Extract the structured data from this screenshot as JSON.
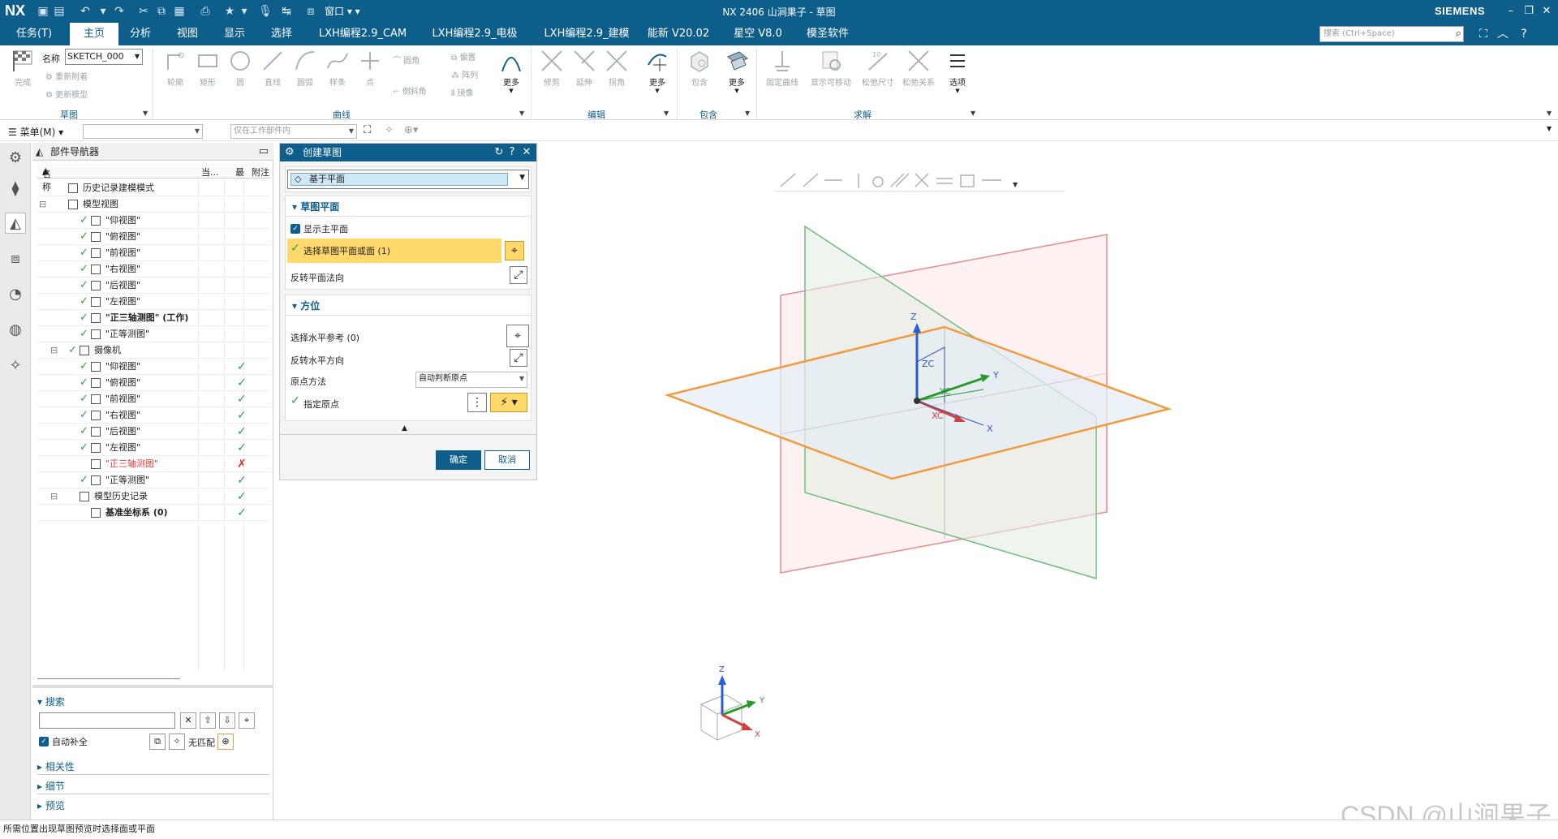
{
  "titlebar": {
    "logo": "NX",
    "title": "NX 2406 山涧果子 - 草图",
    "window_menu": "窗口",
    "brand": "SIEMENS"
  },
  "menu": {
    "tabs": [
      "任务(T)",
      "主页",
      "分析",
      "视图",
      "显示",
      "选择",
      "LXH编程2.9_CAM",
      "LXH编程2.9_电极",
      "LXH编程2.9_建模",
      "能新 V20.02",
      "星空 V8.0",
      "模圣软件"
    ],
    "active_tab": "主页",
    "search_placeholder": "搜索 (Ctrl+Space)"
  },
  "ribbon": {
    "sketch_group": {
      "finish": "完成",
      "name_label": "名称",
      "name_value": "SKETCH_000",
      "update_attach": "重新附着",
      "update_model": "更新模型",
      "label": "草图"
    },
    "curve_group": {
      "items": [
        "轮廓",
        "矩形",
        "圆",
        "直线",
        "圆弧",
        "样条",
        "点"
      ],
      "right_items": [
        "圆角",
        "倒斜角"
      ],
      "small_items": [
        "偏置",
        "阵列",
        "镜像"
      ],
      "more": "更多",
      "label": "曲线"
    },
    "edit_group": {
      "items": [
        "修剪",
        "延伸",
        "拐角"
      ],
      "more": "更多",
      "label": "编辑"
    },
    "include_group": {
      "items": [
        "包含"
      ],
      "more": "更多",
      "label": "包含"
    },
    "solve_group": {
      "items": [
        "固定曲线",
        "显示可移动",
        "松弛尺寸",
        "松弛关系"
      ],
      "options": "选项",
      "label": "求解"
    }
  },
  "toolbar2": {
    "menu": "菜单(M)",
    "filter_combo": "",
    "scope_combo": "仅在工作部件内"
  },
  "navigator": {
    "title": "部件导航器",
    "columns": [
      "名称",
      "当...",
      "最",
      "附注"
    ],
    "rows": [
      {
        "label": "历史记录建模模式",
        "indent": 0,
        "check": false,
        "col3": ""
      },
      {
        "label": "模型视图",
        "indent": 0,
        "check": false,
        "col3": "",
        "tree": "-"
      },
      {
        "label": "\"仰视图\"",
        "indent": 2,
        "check": true,
        "col3": ""
      },
      {
        "label": "\"俯视图\"",
        "indent": 2,
        "check": true,
        "col3": ""
      },
      {
        "label": "\"前视图\"",
        "indent": 2,
        "check": true,
        "col3": ""
      },
      {
        "label": "\"右视图\"",
        "indent": 2,
        "check": true,
        "col3": ""
      },
      {
        "label": "\"后视图\"",
        "indent": 2,
        "check": true,
        "col3": ""
      },
      {
        "label": "\"左视图\"",
        "indent": 2,
        "check": true,
        "col3": ""
      },
      {
        "label": "\"正三轴测图\" (工作)",
        "indent": 2,
        "check": true,
        "col3": "",
        "bold": true
      },
      {
        "label": "\"正等测图\"",
        "indent": 2,
        "check": true,
        "col3": ""
      },
      {
        "label": "摄像机",
        "indent": 1,
        "check": true,
        "col3": "",
        "tree": "-"
      },
      {
        "label": "\"仰视图\"",
        "indent": 2,
        "check": true,
        "col3": "✓"
      },
      {
        "label": "\"俯视图\"",
        "indent": 2,
        "check": true,
        "col3": "✓"
      },
      {
        "label": "\"前视图\"",
        "indent": 2,
        "check": true,
        "col3": "✓"
      },
      {
        "label": "\"右视图\"",
        "indent": 2,
        "check": true,
        "col3": "✓"
      },
      {
        "label": "\"后视图\"",
        "indent": 2,
        "check": true,
        "col3": "✓"
      },
      {
        "label": "\"左视图\"",
        "indent": 2,
        "check": true,
        "col3": "✓"
      },
      {
        "label": "\"正三轴测图\"",
        "indent": 2,
        "check": false,
        "col3": "✗",
        "red": true
      },
      {
        "label": "\"正等测图\"",
        "indent": 2,
        "check": true,
        "col3": "✓"
      },
      {
        "label": "模型历史记录",
        "indent": 1,
        "check": false,
        "col3": "✓",
        "tree": "-"
      },
      {
        "label": "基准坐标系 (0)",
        "indent": 2,
        "check": false,
        "col3": "✓",
        "bold": true
      }
    ],
    "search": {
      "title": "搜索",
      "autocomplete": "自动补全",
      "no_match": "无匹配"
    },
    "sections": [
      "相关性",
      "细节",
      "预览"
    ]
  },
  "dialog": {
    "title": "创建草图",
    "type_value": "基于平面",
    "sketch_plane": {
      "title": "草图平面",
      "show_main_plane": "显示主平面",
      "select_plane": "选择草图平面或面 (1)",
      "reverse_normal": "反转平面法向"
    },
    "orientation": {
      "title": "方位",
      "select_horizontal": "选择水平参考 (0)",
      "reverse_horizontal": "反转水平方向",
      "origin_method_label": "原点方法",
      "origin_method_value": "自动判断原点",
      "specify_origin": "指定原点"
    },
    "ok": "确定",
    "cancel": "取消"
  },
  "viewport": {
    "axes": {
      "z": "Z",
      "y": "Y",
      "x": "X",
      "zc": "ZC",
      "yc": "YC",
      "xc": "XC"
    },
    "triad": {
      "z": "Z",
      "y": "Y",
      "x": "X"
    }
  },
  "status_text": "所需位置出现草图预览时选择面或平面",
  "watermark": "CSDN @山涧果子",
  "colors": {
    "primary": "#0e5e8c",
    "highlight": "#ffd96b",
    "plane_orange": "#f39a3a",
    "plane_green": "#6bbd7a",
    "plane_red": "#e98a8a"
  }
}
